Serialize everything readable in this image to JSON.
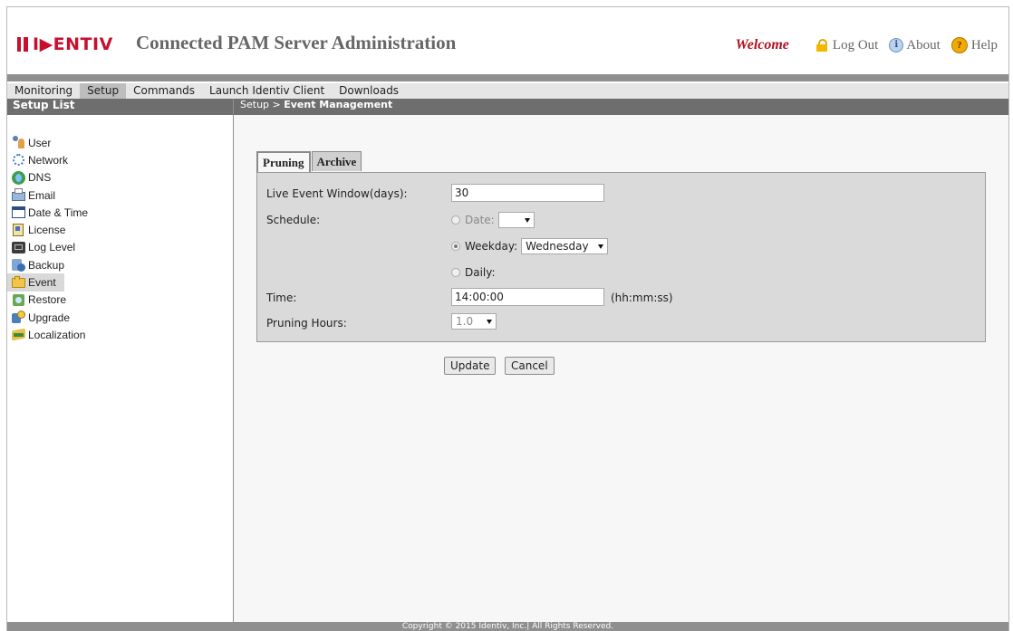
{
  "header": {
    "logo_text": "I▶ENTIV",
    "title": "Connected PAM Server Administration",
    "welcome": "Welcome",
    "logout": "Log Out",
    "about": "About",
    "help": "Help"
  },
  "menu": [
    {
      "label": "Monitoring",
      "active": false
    },
    {
      "label": "Setup",
      "active": true
    },
    {
      "label": "Commands",
      "active": false
    },
    {
      "label": "Launch Identiv Client",
      "active": false
    },
    {
      "label": "Downloads",
      "active": false
    }
  ],
  "sidebar": {
    "title": "Setup List",
    "items": [
      {
        "label": "User",
        "icon": "user-icon"
      },
      {
        "label": "Network",
        "icon": "network-icon"
      },
      {
        "label": "DNS",
        "icon": "dns-icon"
      },
      {
        "label": "Email",
        "icon": "email-icon"
      },
      {
        "label": "Date & Time",
        "icon": "date-time-icon"
      },
      {
        "label": "License",
        "icon": "license-icon"
      },
      {
        "label": "Log Level",
        "icon": "log-level-icon"
      },
      {
        "label": "Backup",
        "icon": "backup-icon"
      },
      {
        "label": "Event",
        "icon": "event-icon",
        "active": true
      },
      {
        "label": "Restore",
        "icon": "restore-icon"
      },
      {
        "label": "Upgrade",
        "icon": "upgrade-icon"
      },
      {
        "label": "Localization",
        "icon": "localization-icon"
      }
    ]
  },
  "breadcrumb": {
    "parent": "Setup >",
    "current": "Event Management"
  },
  "tabs": [
    {
      "label": "Pruning",
      "active": true
    },
    {
      "label": "Archive",
      "active": false
    }
  ],
  "form": {
    "live_window_label": "Live Event Window(days):",
    "live_window_value": "30",
    "schedule_label": "Schedule:",
    "date_option": "Date:",
    "date_value": "",
    "weekday_option": "Weekday:",
    "weekday_value": "Wednesday",
    "daily_option": "Daily:",
    "schedule_selected": "Weekday",
    "time_label": "Time:",
    "time_value": "14:00:00",
    "time_hint": "(hh:mm:ss)",
    "pruning_hours_label": "Pruning Hours:",
    "pruning_hours_value": "1.0"
  },
  "buttons": {
    "update": "Update",
    "cancel": "Cancel"
  },
  "footer": {
    "text": "Copyright © 2015 Identiv, Inc.| All Rights Reserved."
  },
  "colors": {
    "brand_red": "#c8102e",
    "bar_gray": "#8f8f8f",
    "panel_gray": "#dadada"
  }
}
